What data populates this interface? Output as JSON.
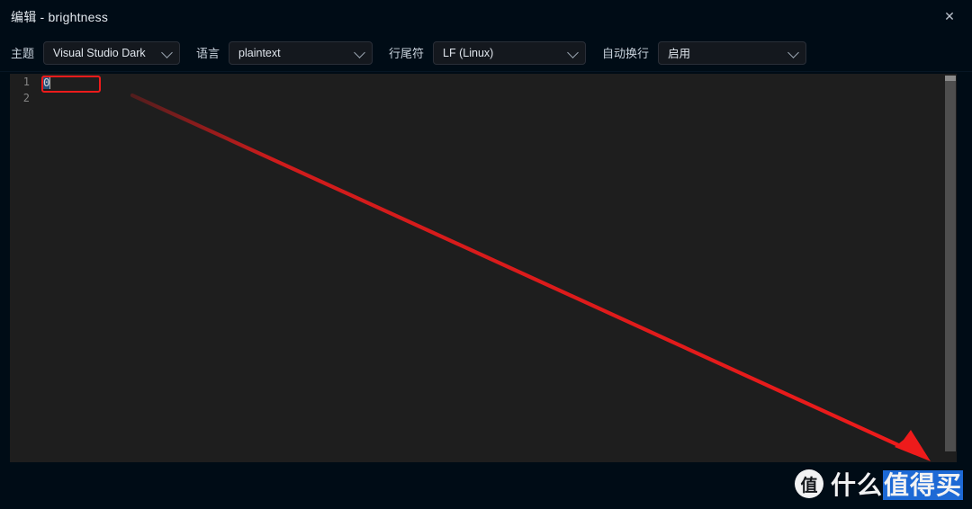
{
  "window": {
    "title": "编辑 - brightness",
    "close_icon": "close-icon",
    "close_glyph": "✕"
  },
  "toolbar": {
    "fields": [
      {
        "label": "主题",
        "value": "Visual Studio Dark",
        "name": "theme"
      },
      {
        "label": "语言",
        "value": "plaintext",
        "name": "language"
      },
      {
        "label": "行尾符",
        "value": "LF (Linux)",
        "name": "line-ending"
      },
      {
        "label": "自动换行",
        "value": "启用",
        "name": "word-wrap"
      }
    ]
  },
  "editor": {
    "lines": [
      {
        "number": "1",
        "text": "0",
        "selected": true
      },
      {
        "number": "2",
        "text": "",
        "selected": false
      }
    ],
    "background": "#1e1e1e",
    "selection_color": "#264f78",
    "line_number_color": "#858585",
    "scrollbar": {
      "name": "vertical-scrollbar"
    }
  },
  "annotation": {
    "rect_color": "#ee1b1b",
    "arrow_color": "#ee1b1b",
    "arrow_from": "145,105",
    "arrow_to": "1032,512"
  },
  "watermark": {
    "badge": "值",
    "text_plain": "什么",
    "text_highlight": "值得买",
    "highlight_color": "#1f6fe0"
  }
}
